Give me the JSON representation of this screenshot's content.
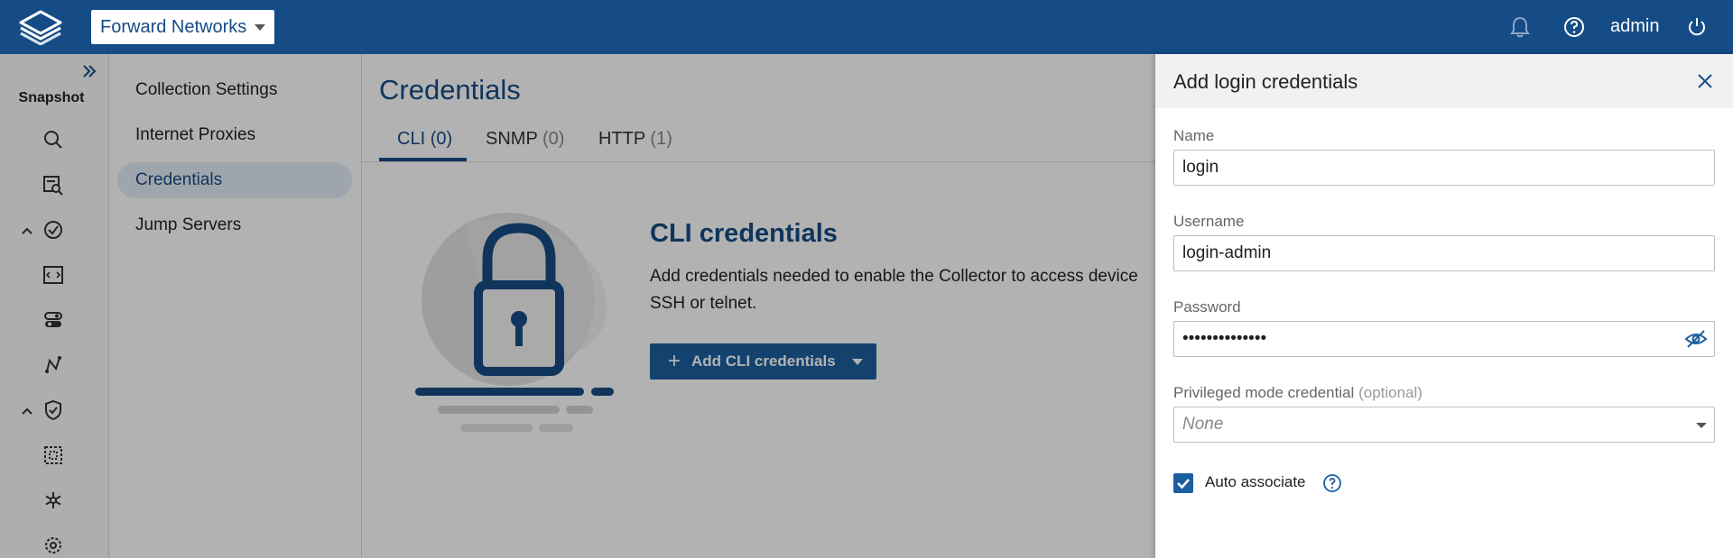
{
  "app": {
    "network_selector": "Forward Networks",
    "user": "admin",
    "icons": [
      "logo-icon",
      "bell-icon",
      "help-icon",
      "power-icon"
    ]
  },
  "rail": {
    "label": "Snapshot",
    "icons": [
      "expand-icon",
      "search-icon",
      "inventory-search-icon",
      "check-circle-icon",
      "code-icon",
      "toggle-icon",
      "path-icon",
      "shield-icon",
      "grid-icon",
      "snowflake-icon",
      "settings-icon"
    ]
  },
  "subnav": {
    "items": [
      {
        "label": "Collection Settings",
        "active": false
      },
      {
        "label": "Internet Proxies",
        "active": false
      },
      {
        "label": "Credentials",
        "active": true
      },
      {
        "label": "Jump Servers",
        "active": false
      }
    ]
  },
  "main": {
    "title": "Credentials",
    "tabs": [
      {
        "label": "CLI",
        "count": "(0)",
        "active": true
      },
      {
        "label": "SNMP",
        "count": "(0)",
        "active": false
      },
      {
        "label": "HTTP",
        "count": "(1)",
        "active": false
      }
    ],
    "empty_state": {
      "heading": "CLI credentials",
      "description": "Add credentials needed to enable the Collector to access device SSH or telnet.",
      "button_label": "Add CLI credentials"
    }
  },
  "drawer": {
    "title": "Add login credentials",
    "name": {
      "label": "Name",
      "value": "login"
    },
    "username": {
      "label": "Username",
      "value": "login-admin"
    },
    "password": {
      "label": "Password",
      "value": "••••••••••••••"
    },
    "privileged": {
      "label": "Privileged mode credential",
      "optional": "(optional)",
      "value": "None"
    },
    "auto_associate": {
      "label": "Auto associate",
      "checked": true
    }
  },
  "colors": {
    "brand": "#164c86",
    "button": "#1c5fa0",
    "overlay": "rgba(0,0,0,0.30)"
  }
}
